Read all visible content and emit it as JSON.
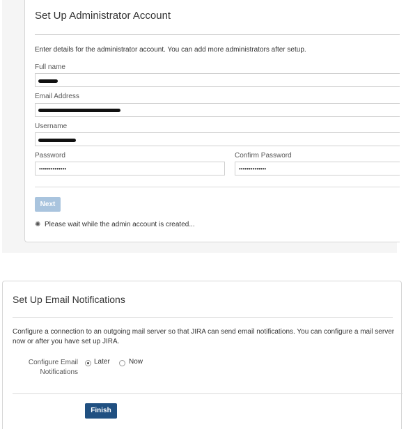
{
  "admin": {
    "title": "Set Up Administrator Account",
    "intro": "Enter details for the administrator account. You can add more administrators after setup.",
    "full_name_label": "Full name",
    "email_label": "Email Address",
    "username_label": "Username",
    "password_label": "Password",
    "confirm_password_label": "Confirm Password",
    "password_value": "••••••••••••••",
    "confirm_password_value": "••••••••••••••",
    "next_label": "Next",
    "wait_message": "Please wait while the admin account is created...",
    "spinner_glyph": "✺"
  },
  "email": {
    "title": "Set Up Email Notifications",
    "description": "Configure a connection to an outgoing mail server so that JIRA can send email notifications. You can configure a mail server now or after you have set up JIRA.",
    "configure_label": "Configure Email Notifications",
    "option_later": "Later",
    "option_now": "Now",
    "selected": "Later",
    "finish_label": "Finish"
  },
  "colors": {
    "primary_button": "#205081",
    "disabled_button": "#a9c4de"
  }
}
